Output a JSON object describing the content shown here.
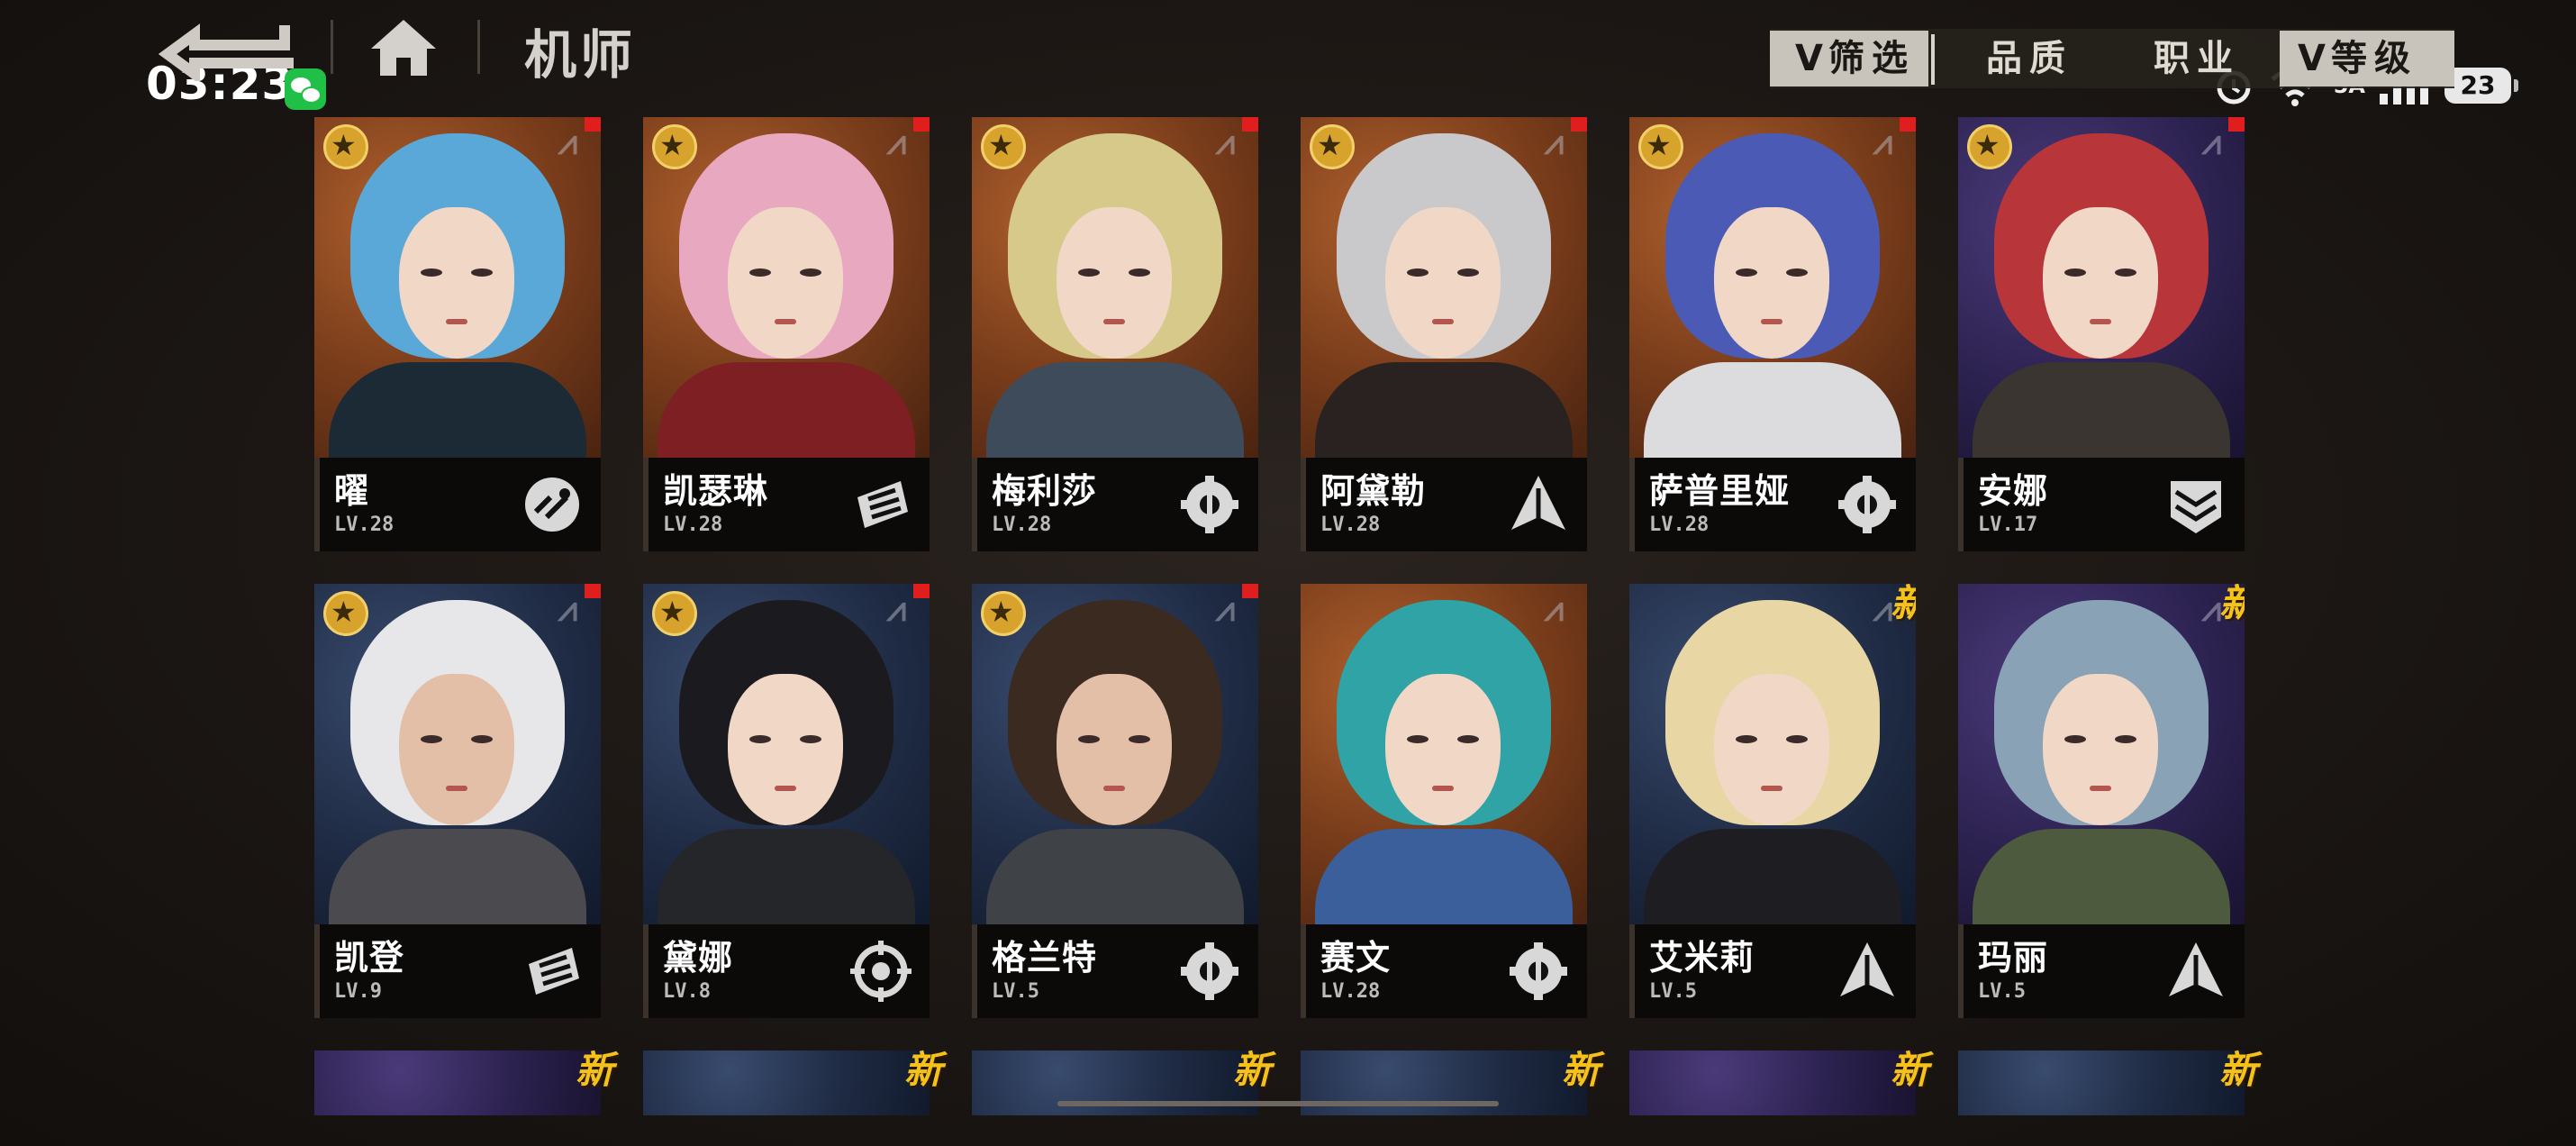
{
  "status_bar": {
    "time": "03:23",
    "notif_app": "wechat-icon",
    "battery": "23",
    "network": "5A"
  },
  "header": {
    "title": "机师"
  },
  "filter": {
    "filter_label": "筛选",
    "quality_label": "品质",
    "class_label": "职业",
    "level_label": "等级",
    "chevron": "V"
  },
  "pilots": [
    {
      "name": "曜",
      "level": "LV.28",
      "class_icon": "circuit-icon",
      "bg": "orange",
      "hair": "#5aa8d8",
      "body": "#1c2a36",
      "face": "female",
      "star": true,
      "badge": "red"
    },
    {
      "name": "凯瑟琳",
      "level": "LV.28",
      "class_icon": "shield-lines-icon",
      "bg": "orange",
      "hair": "#e7a8c0",
      "body": "#7e1f24",
      "face": "female",
      "star": true,
      "badge": "red"
    },
    {
      "name": "梅利莎",
      "level": "LV.28",
      "class_icon": "gear-wrench-icon",
      "bg": "orange",
      "hair": "#d6c98a",
      "body": "#3d4b5a",
      "face": "female",
      "star": true,
      "badge": "red"
    },
    {
      "name": "阿黛勒",
      "level": "LV.28",
      "class_icon": "arrow-up-icon",
      "bg": "orange",
      "hair": "#c9c9cc",
      "body": "#2a2220",
      "face": "female",
      "star": true,
      "badge": "red"
    },
    {
      "name": "萨普里娅",
      "level": "LV.28",
      "class_icon": "gear-wrench-icon",
      "bg": "orange",
      "hair": "#4b5ab5",
      "body": "#dcdcde",
      "face": "female",
      "star": true,
      "badge": "red"
    },
    {
      "name": "安娜",
      "level": "LV.17",
      "class_icon": "chevron-shield-icon",
      "bg": "purple",
      "hair": "#b8363a",
      "body": "#3a3530",
      "face": "female",
      "star": true,
      "badge": "red"
    },
    {
      "name": "凯登",
      "level": "LV.9",
      "class_icon": "shield-lines-icon",
      "bg": "navy",
      "hair": "#e7e7ea",
      "body": "#4a4a4f",
      "face": "male",
      "star": true,
      "badge": "red"
    },
    {
      "name": "黛娜",
      "level": "LV.8",
      "class_icon": "crosshair-icon",
      "bg": "navy",
      "hair": "#1b1b1f",
      "body": "#252629",
      "face": "female",
      "star": true,
      "badge": "red"
    },
    {
      "name": "格兰特",
      "level": "LV.5",
      "class_icon": "gear-wrench-icon",
      "bg": "navy",
      "hair": "#3a2a20",
      "body": "#3f4246",
      "face": "male",
      "star": true,
      "badge": "red"
    },
    {
      "name": "赛文",
      "level": "LV.28",
      "class_icon": "gear-wrench-icon",
      "bg": "orange",
      "hair": "#2fa3a6",
      "body": "#3a5f9a",
      "face": "female",
      "star": false,
      "badge": "none"
    },
    {
      "name": "艾米莉",
      "level": "LV.5",
      "class_icon": "arrow-up-icon",
      "bg": "navy",
      "hair": "#e8d7a4",
      "body": "#1d1d22",
      "face": "female",
      "star": false,
      "badge": "new"
    },
    {
      "name": "玛丽",
      "level": "LV.5",
      "class_icon": "arrow-up-icon",
      "bg": "purple",
      "hair": "#8aa2b5",
      "body": "#4d5a3e",
      "face": "female",
      "star": false,
      "badge": "new"
    }
  ],
  "partial_row": {
    "badge_text": "新",
    "count": 6,
    "backgrounds": [
      "purple",
      "navy",
      "navy",
      "navy",
      "purple",
      "navy"
    ]
  }
}
